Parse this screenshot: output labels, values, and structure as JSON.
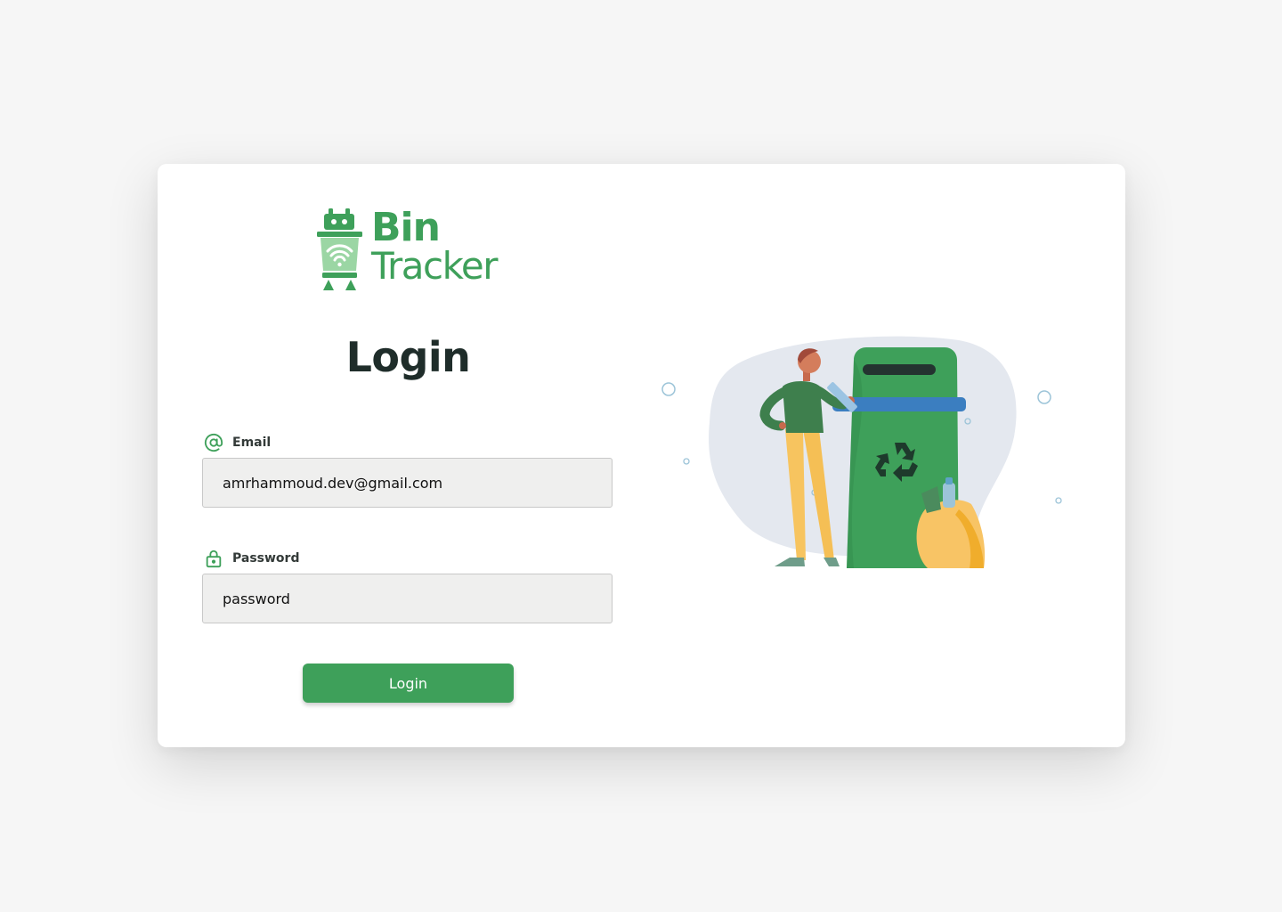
{
  "brand": {
    "line1": "Bin",
    "line2": "Tracker",
    "color": "#3ea05a"
  },
  "page_title": "Login",
  "email": {
    "label": "Email",
    "icon": "at-sign-icon",
    "value": "amrhammoud.dev@gmail.com"
  },
  "password": {
    "label": "Password",
    "icon": "lock-icon",
    "value": "password"
  },
  "login_button": {
    "label": "Login"
  },
  "colors": {
    "accent": "#3ea05a",
    "title": "#1f2d2a",
    "input_bg": "#efefee",
    "page_bg": "#f6f6f6"
  }
}
